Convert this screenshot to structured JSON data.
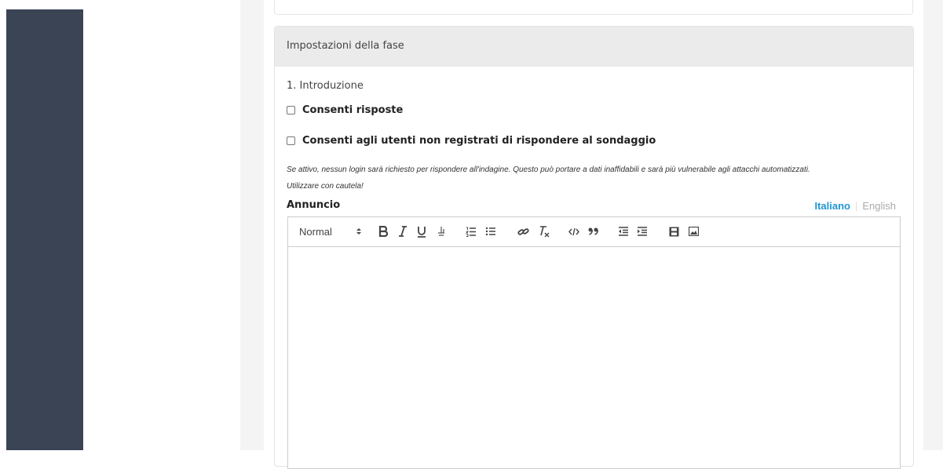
{
  "phase_settings": {
    "header_title": "Impostazioni della fase",
    "phase_name": "1. Introduzione",
    "options": [
      {
        "label": "Consenti risposte",
        "checked": false
      },
      {
        "label": "Consenti agli utenti non registrati di rispondere al sondaggio",
        "checked": false
      }
    ],
    "help_text_line1": "Se attivo, nessun login sarà richiesto per rispondere all'indagine. Questo può portare a dati inaffidabili e sarà più vulnerabile agli attacchi automatizzati.",
    "help_text_line2": "Utilizzare con cautela!"
  },
  "announcement": {
    "label": "Annuncio",
    "languages": {
      "active": "Italiano",
      "inactive": "English"
    },
    "toolbar": {
      "format_select": "Normal",
      "icons": [
        "bold-icon",
        "italic-icon",
        "underline-icon",
        "strike-icon",
        "ordered-list-icon",
        "bullet-list-icon",
        "link-icon",
        "clear-format-icon",
        "code-icon",
        "blockquote-icon",
        "outdent-icon",
        "indent-icon",
        "video-icon",
        "image-icon"
      ]
    },
    "body": ""
  },
  "colors": {
    "sidebar": "#3b4455",
    "accent": "#2196d3",
    "header_bg": "#ebebeb"
  }
}
